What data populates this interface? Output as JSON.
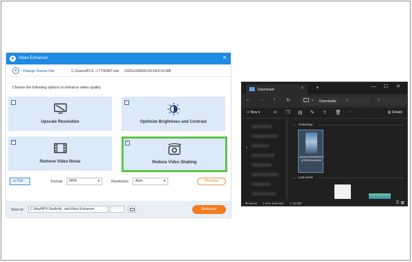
{
  "enhancer": {
    "title": "Video Enhancer",
    "close_icon": "×",
    "change_source_label": "Change Source File",
    "file_path": "C:/Users/AT-6...l-7730387.mts",
    "file_meta": "1920x1080/00:00:04/3.53 MB",
    "choose_text": "Choose the following options to enhance video quality.",
    "options": [
      {
        "label": "Upscale Resolution",
        "checked": false,
        "icon": "monitor-slash-icon"
      },
      {
        "label": "Optimize Brightness and Contrast",
        "checked": true,
        "icon": "brightness-icon"
      },
      {
        "label": "Remove Video Noise",
        "checked": true,
        "icon": "film-strip-icon"
      },
      {
        "label": "Reduce Video Shaking",
        "checked": true,
        "icon": "stabilize-camera-icon"
      }
    ],
    "highlight_color": "#5cc344",
    "cut_label": "Cut",
    "format_label": "Format:",
    "format_value": "MP4",
    "resolution_label": "Resolution:",
    "resolution_value": "Auto",
    "preview_label": "Preview",
    "save_to_label": "Save to:",
    "save_path": "C:\\AnyMP4 Studio\\A...ate\\Video Enhancer",
    "browse_label": "···",
    "enhance_label": "Enhance",
    "accent_color": "#f47b20",
    "title_color": "#1d8ae3"
  },
  "explorer": {
    "tab_title": "Downloads",
    "tab_close": "×",
    "new_tab": "+",
    "window_controls": [
      "—",
      "☐",
      "✕"
    ],
    "address": "Downloads",
    "address_sep": ">",
    "new_label": "New",
    "details_label": "Details",
    "groups": [
      "Yesterday",
      "Last week"
    ],
    "file_name": "a62acc33e2bdf9a57b7939221b24b08",
    "status_items": "90 items",
    "status_selected": "1 item selected",
    "status_size": "4.19 MB"
  }
}
